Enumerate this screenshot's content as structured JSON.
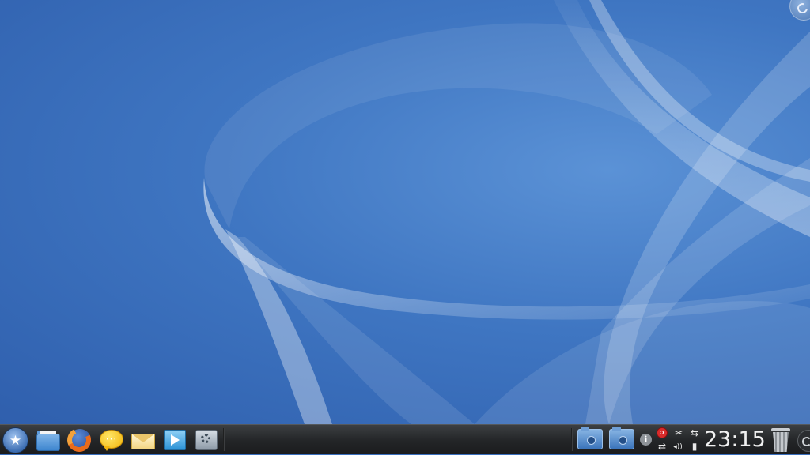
{
  "desktop": {
    "wallpaper": "blue-curves",
    "accent_colors": [
      "#3a6fbd",
      "#5b92d6",
      "#2f5fad"
    ]
  },
  "panel": {
    "launcher": {
      "icon": "kde-star-icon",
      "glyph": "★"
    },
    "quicklaunch": [
      {
        "name": "file-manager",
        "icon": "folder-icon"
      },
      {
        "name": "web-browser",
        "icon": "firefox-icon"
      },
      {
        "name": "instant-messenger",
        "icon": "chat-bubble-icon",
        "glyph": "···"
      },
      {
        "name": "mail-client",
        "icon": "envelope-icon"
      },
      {
        "name": "media-player",
        "icon": "play-icon"
      },
      {
        "name": "system-settings",
        "icon": "settings-icon"
      }
    ],
    "pager": [
      {
        "name": "desktop-1",
        "icon": "desktop-folder-icon"
      },
      {
        "name": "desktop-2",
        "icon": "desktop-folder-icon"
      }
    ],
    "tray": {
      "info_glyph": "i",
      "klipper_glyph": "✂",
      "usb_glyph": "⇆",
      "network_glyph": "⇄",
      "volume_glyph": "◂))",
      "battery_glyph": "▮"
    },
    "clock": {
      "time": "23:15"
    },
    "trash": {
      "icon": "trash-icon"
    }
  }
}
